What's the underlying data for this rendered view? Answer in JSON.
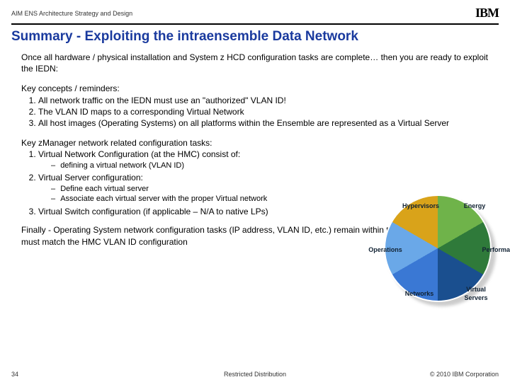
{
  "header": {
    "label": "AIM ENS Architecture Strategy and Design",
    "logo": "IBM"
  },
  "title": "Summary - Exploiting the intraensemble Data Network",
  "intro": "Once all hardware / physical installation and System z HCD configuration tasks are complete… then you are ready to exploit the IEDN:",
  "concepts": {
    "heading": "Key concepts / reminders:",
    "items": [
      "All network traffic on the IEDN must use an \"authorized\" VLAN ID!",
      "The VLAN ID maps to a corresponding Virtual Network",
      "All host images (Operating Systems) on all platforms within the Ensemble are represented as a Virtual Server"
    ]
  },
  "tasks": {
    "heading": "Key zManager network related configuration tasks:",
    "items": [
      {
        "label": "Virtual Network Configuration (at the HMC) consist of:",
        "subs": [
          "defining a virtual network (VLAN ID)"
        ]
      },
      {
        "label": "Virtual Server configuration:",
        "subs": [
          "Define each virtual server",
          "Associate each virtual server with the proper Virtual network"
        ]
      },
      {
        "label": "Virtual Switch configuration (if applicable – N/A to native LPs)",
        "subs": []
      }
    ]
  },
  "final": "Finally - Operating System network configuration tasks (IP address, VLAN ID, etc.) remain within the OS – the OS VLAN ID must match the HMC VLAN ID configuration",
  "chart_data": {
    "type": "pie",
    "title": "",
    "categories": [
      "Hypervisors",
      "Energy",
      "Performance",
      "Virtual Servers",
      "Networks",
      "Operations"
    ],
    "values": [
      1,
      1,
      1,
      1,
      1,
      1
    ]
  },
  "footer": {
    "page": "34",
    "center": "Restricted Distribution",
    "right": "© 2010 IBM Corporation"
  }
}
